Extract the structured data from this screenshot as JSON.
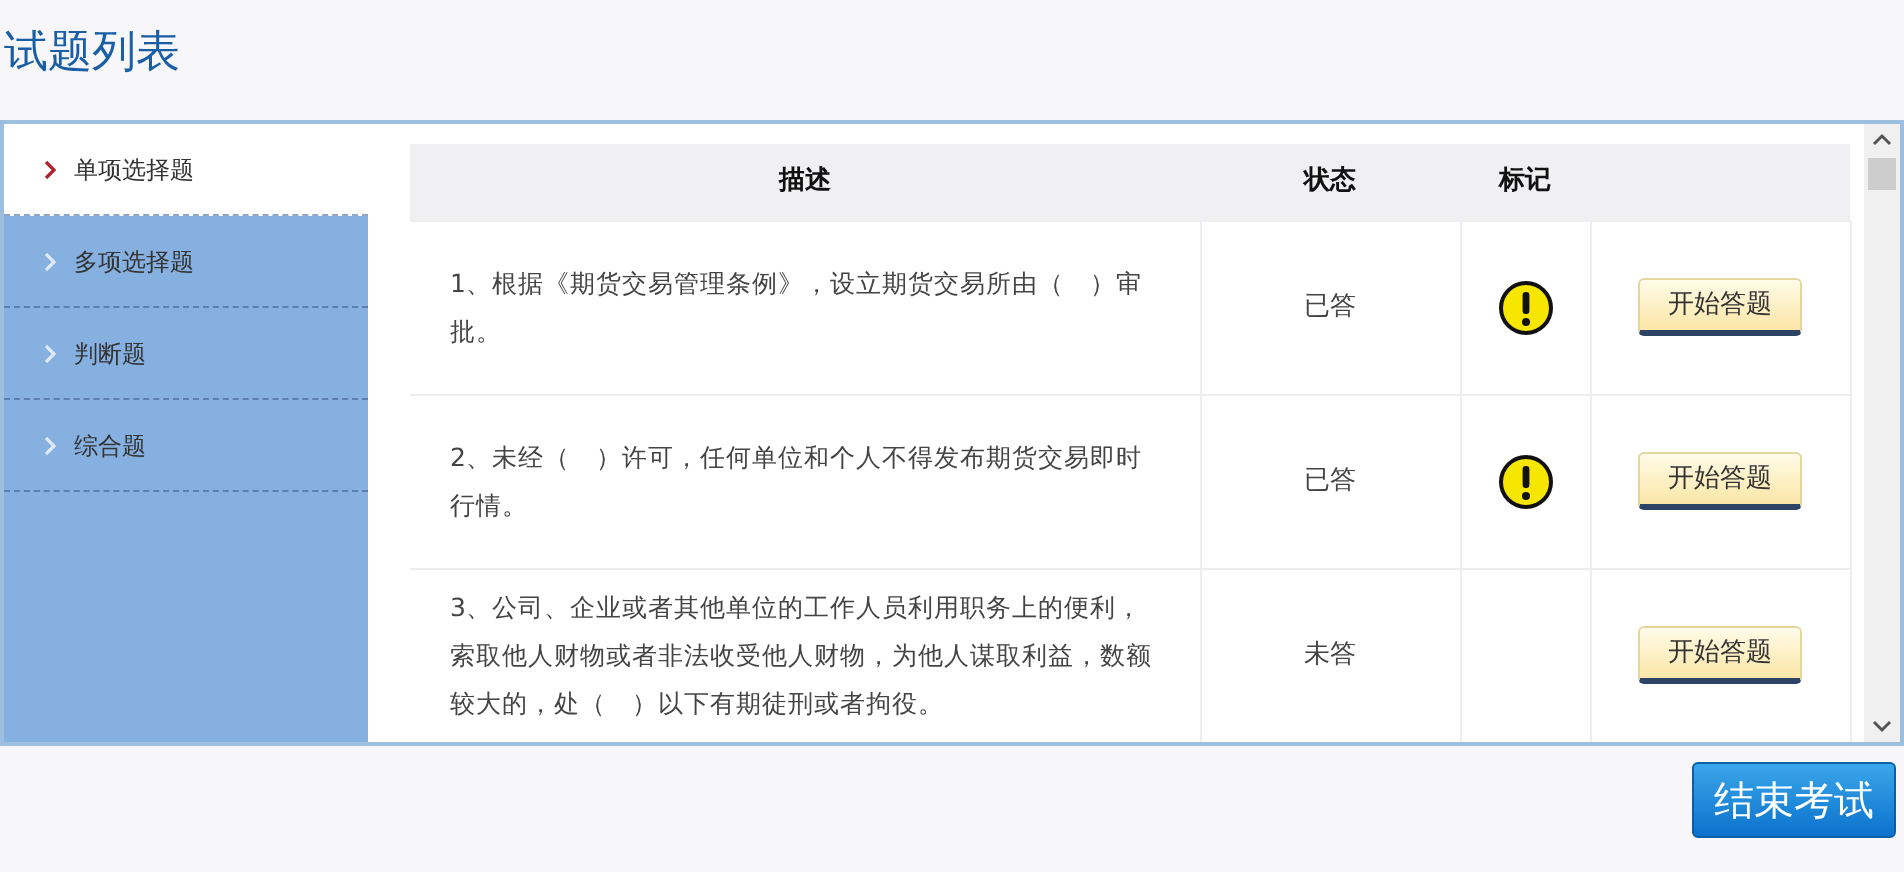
{
  "title": "试题列表",
  "sidebar": {
    "items": [
      {
        "label": "单项选择题",
        "selected": true
      },
      {
        "label": "多项选择题",
        "selected": false
      },
      {
        "label": "判断题",
        "selected": false
      },
      {
        "label": "综合题",
        "selected": false
      }
    ]
  },
  "table": {
    "columns": [
      "描述",
      "状态",
      "标记"
    ],
    "rows": [
      {
        "description": "1、根据《期货交易管理条例》，设立期货交易所由（　）审批。",
        "status": "已答",
        "flagged": true,
        "action": "开始答题"
      },
      {
        "description": "2、未经（　）许可，任何单位和个人不得发布期货交易即时行情。",
        "status": "已答",
        "flagged": true,
        "action": "开始答题"
      },
      {
        "description": "3、公司、企业或者其他单位的工作人员利用职务上的便利，索取他人财物或者非法收受他人财物，为他人谋取利益，数额较大的，处（　）以下有期徒刑或者拘役。",
        "status": "未答",
        "flagged": false,
        "action": "开始答题"
      }
    ]
  },
  "end_button": "结束考试"
}
